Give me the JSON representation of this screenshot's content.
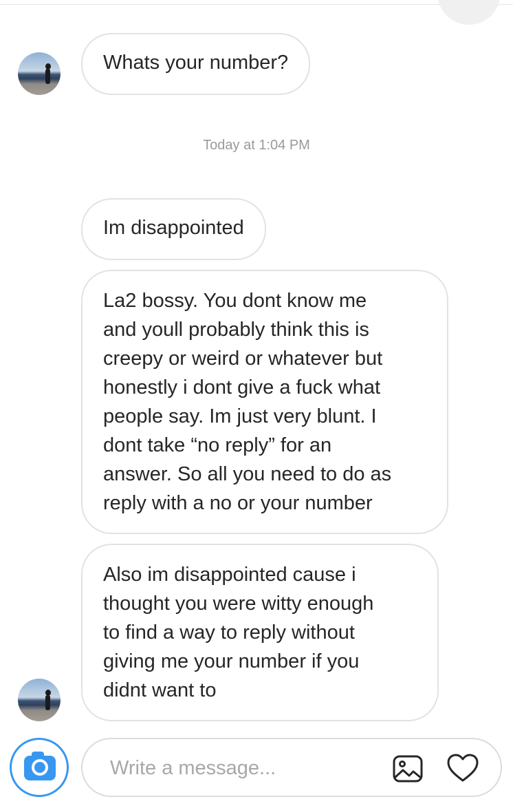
{
  "conversation": {
    "received_first": {
      "text": "Whats your number?"
    },
    "timestamp": "Today at 1:04 PM",
    "messages": [
      {
        "lines": [
          "Im disappointed"
        ]
      },
      {
        "lines": [
          "La2 bossy. You dont know me",
          "and youll probably think this is",
          "creepy or weird or whatever but",
          "honestly i dont give a fuck what",
          "people say. Im just very blunt. I",
          "dont take “no reply” for an",
          "answer. So all you need to do as",
          "reply with a no or your number"
        ]
      },
      {
        "lines": [
          "Also im disappointed cause i",
          "thought you were witty enough",
          "to find a way to reply without",
          "giving me your number if you",
          "didnt want to"
        ]
      }
    ]
  },
  "composer": {
    "placeholder": "Write a message...",
    "icons": {
      "camera": "camera-icon",
      "gallery": "gallery-icon",
      "like": "heart-icon"
    }
  },
  "colors": {
    "accent": "#3897f0",
    "bubble_border": "#e2e2e2",
    "text": "#262626",
    "timestamp": "#999999"
  }
}
